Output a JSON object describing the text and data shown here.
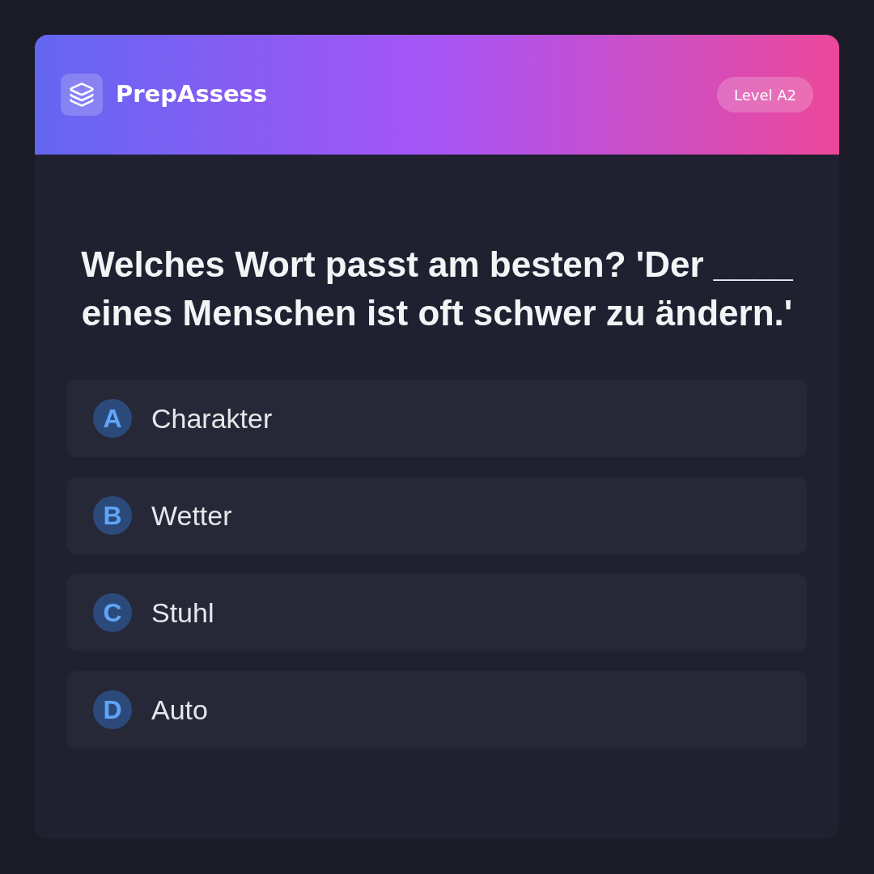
{
  "header": {
    "app_name": "PrepAssess",
    "level_badge": "Level A2"
  },
  "question": {
    "text": "Welches Wort passt am besten? 'Der ____ eines Menschen ist oft schwer zu ändern.'"
  },
  "options": [
    {
      "letter": "A",
      "text": "Charakter",
      "selected": false
    },
    {
      "letter": "B",
      "text": "Wetter",
      "selected": false
    },
    {
      "letter": "C",
      "text": "Stuhl",
      "selected": false
    },
    {
      "letter": "D",
      "text": "Auto",
      "selected": false
    }
  ]
}
